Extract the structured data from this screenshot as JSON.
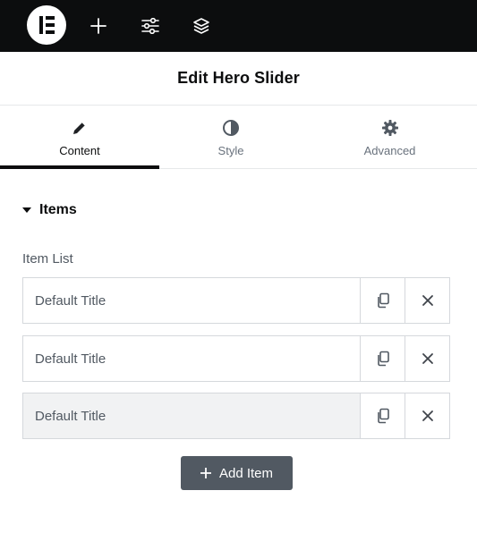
{
  "topbar": {
    "icons": [
      "elementor-logo-icon",
      "plus-icon",
      "sliders-icon",
      "layers-icon"
    ]
  },
  "editor": {
    "title": "Edit Hero Slider"
  },
  "tabs": [
    {
      "label": "Content",
      "icon": "pencil-icon",
      "active": true
    },
    {
      "label": "Style",
      "icon": "contrast-icon",
      "active": false
    },
    {
      "label": "Advanced",
      "icon": "gear-icon",
      "active": false
    }
  ],
  "section": {
    "title": "Items",
    "expanded": true
  },
  "item_list": {
    "label": "Item List",
    "items": [
      {
        "title": "Default Title",
        "selected": false
      },
      {
        "title": "Default Title",
        "selected": false
      },
      {
        "title": "Default Title",
        "selected": true
      }
    ],
    "add_label": "Add Item"
  },
  "colors": {
    "topbar": "#0c0d0e",
    "active_tab_indicator": "#0c0d0e",
    "add_button": "#515962",
    "selected_row": "#f1f2f3"
  }
}
